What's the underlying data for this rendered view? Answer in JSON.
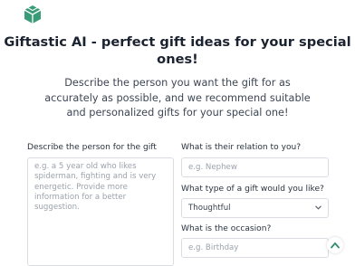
{
  "header": {
    "logo_icon": "green-box-logo-icon",
    "title": "Giftastic AI - perfect gift ideas for your special ones!",
    "subtitle": "Describe the person you want the gift for as accurately as possible, and we recommend suitable and personalized gifts for your special one!"
  },
  "form": {
    "description": {
      "label": "Describe the person for the gift",
      "placeholder": "e.g. a 5 year old who likes spiderman, fighting and is very energetic. Provide more information for a better suggestion."
    },
    "relation": {
      "label": "What is their relation to you?",
      "placeholder": "e.g. Nephew"
    },
    "gift_type": {
      "label": "What type of a gift would you like?",
      "value": "Thoughtful",
      "icon": "chevron-down-icon"
    },
    "occasion": {
      "label": "What is the occasion?",
      "placeholder": "e.g. Birthday"
    }
  },
  "scroll_top": {
    "icon": "chevron-up-icon"
  },
  "colors": {
    "brand_green": "#3a9b78",
    "accent_green": "#2f8f6a"
  }
}
